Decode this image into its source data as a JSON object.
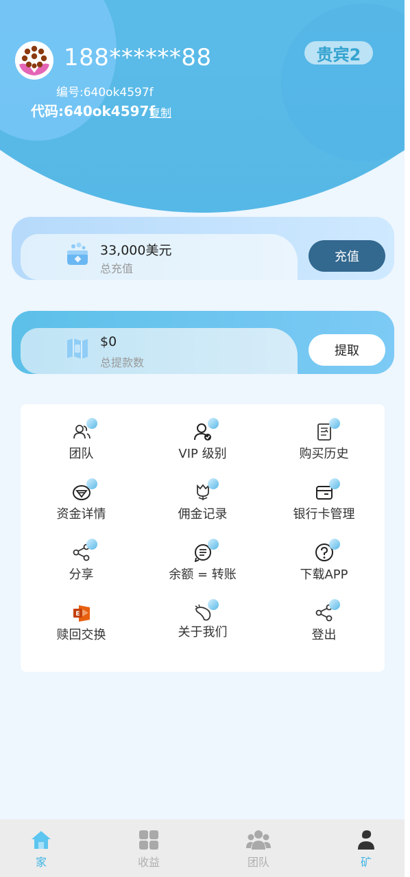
{
  "user": {
    "phone": "188******88",
    "vip_level": "贵宾2",
    "id_line": "编号:640ok4597f",
    "code_line": "代码:640ok4597f",
    "copy_label": "复制"
  },
  "recharge_card": {
    "amount": "33,000美元",
    "label": "总充值",
    "button": "充值"
  },
  "withdraw_card": {
    "amount": "$0",
    "label": "总提款数",
    "button": "提取"
  },
  "menu": [
    {
      "label": "团队",
      "icon": "team-icon"
    },
    {
      "label": "VIP 级别",
      "icon": "vip-level-icon"
    },
    {
      "label": "购买历史",
      "icon": "purchase-history-icon"
    },
    {
      "label": "资金详情",
      "icon": "fund-details-icon"
    },
    {
      "label": "佣金记录",
      "icon": "commission-record-icon"
    },
    {
      "label": "银行卡管理",
      "icon": "bank-card-icon"
    },
    {
      "label": "分享",
      "icon": "share-icon"
    },
    {
      "label": "余额 = 转账",
      "icon": "balance-transfer-icon"
    },
    {
      "label": "下载APP",
      "icon": "download-app-icon"
    },
    {
      "label": "赎回交换",
      "icon": "redeem-exchange-icon"
    },
    {
      "label": "关于我们",
      "icon": "about-us-icon"
    },
    {
      "label": "登出",
      "icon": "logout-icon"
    }
  ],
  "nav": [
    {
      "label": "家",
      "icon": "home-icon",
      "active": true
    },
    {
      "label": "收益",
      "icon": "earnings-icon",
      "active": false
    },
    {
      "label": "团队",
      "icon": "team-nav-icon",
      "active": false
    },
    {
      "label": "矿",
      "icon": "mine-icon",
      "active": false
    }
  ],
  "colors": {
    "accent": "#3fb6e6",
    "header": "#5dbce9",
    "recharge_button": "#33688f",
    "nav_background": "#ececec"
  }
}
